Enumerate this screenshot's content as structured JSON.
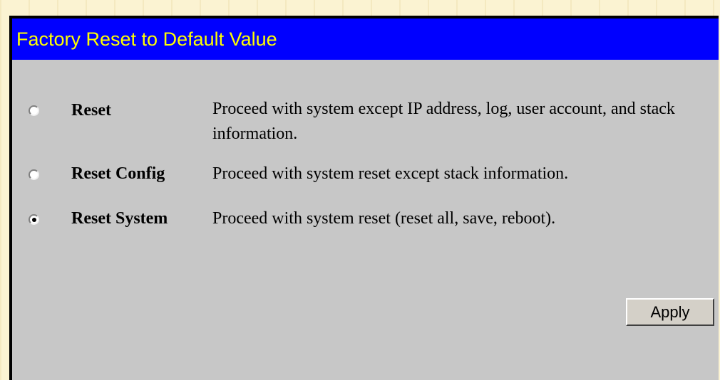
{
  "panel": {
    "title": "Factory Reset to Default Value",
    "title_bg": "#0000ff",
    "title_color": "#ffff00",
    "body_bg": "#c7c7c7"
  },
  "options": [
    {
      "label": "Reset",
      "description": "Proceed with system except IP address, log, user account, and stack information.",
      "selected": false
    },
    {
      "label": "Reset Config",
      "description": "Proceed with system reset except stack information.",
      "selected": false
    },
    {
      "label": "Reset System",
      "description": "Proceed with system reset (reset all, save, reboot).",
      "selected": true
    }
  ],
  "apply_label": "Apply"
}
